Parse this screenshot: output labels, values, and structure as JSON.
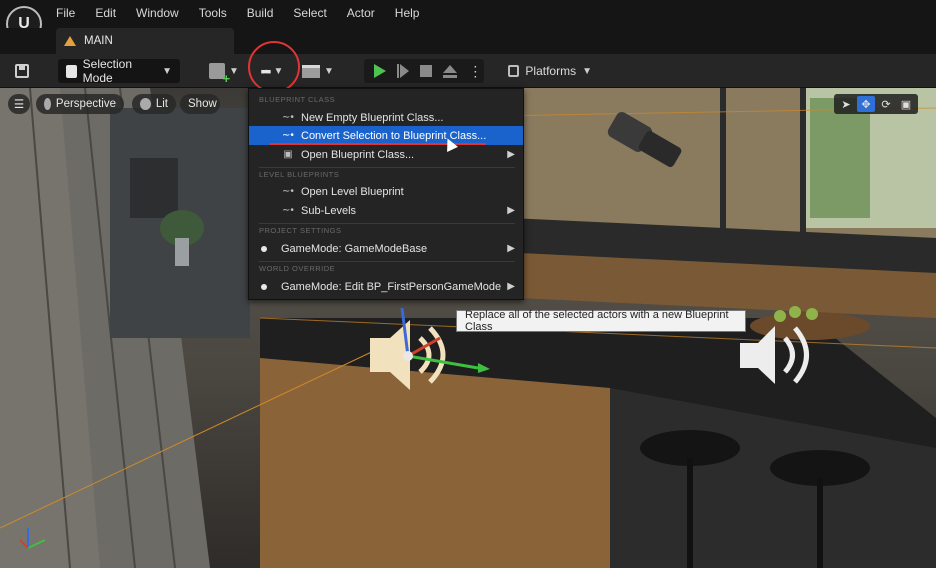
{
  "app": {
    "logo_text": "U"
  },
  "menubar": {
    "items": [
      "File",
      "Edit",
      "Window",
      "Tools",
      "Build",
      "Select",
      "Actor",
      "Help"
    ]
  },
  "tab": {
    "label": "MAIN"
  },
  "toolbar": {
    "selection_mode_label": "Selection Mode",
    "platforms_label": "Platforms"
  },
  "viewport": {
    "perspective_label": "Perspective",
    "lit_label": "Lit",
    "show_label": "Show",
    "tooltip": "Replace all of the selected actors with a new Blueprint Class"
  },
  "dropdown": {
    "sections": {
      "blueprint_class": "Blueprint Class",
      "level_blueprints": "Level Blueprints",
      "project_settings": "Project Settings",
      "world_override": "World Override"
    },
    "items": {
      "new_empty": "New Empty Blueprint Class...",
      "convert": "Convert Selection to Blueprint Class...",
      "open_bp": "Open Blueprint Class...",
      "open_level": "Open Level Blueprint",
      "sublevels": "Sub-Levels",
      "gamemode": "GameMode: GameModeBase",
      "gamemode_edit": "GameMode: Edit BP_FirstPersonGameMode"
    }
  },
  "colors": {
    "highlight": "#1b63cc",
    "annotation_red": "#e23434",
    "play_green": "#4fc34f"
  }
}
